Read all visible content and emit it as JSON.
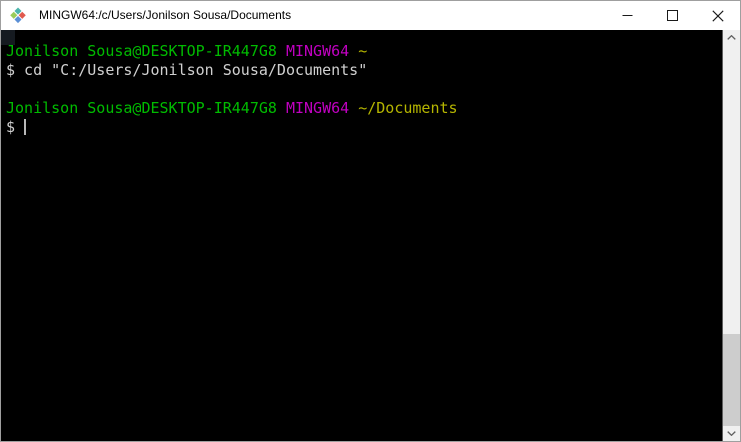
{
  "window": {
    "title": "MINGW64:/c/Users/Jonilson Sousa/Documents"
  },
  "icons": {
    "app": "msys-diamond-icon",
    "minimize": "minimize-icon",
    "maximize": "maximize-icon",
    "close": "close-icon",
    "scroll_up": "chevron-up-icon",
    "scroll_down": "chevron-down-icon"
  },
  "colors": {
    "green": "#00bb00",
    "magenta": "#c000c0",
    "yellow": "#b5b500",
    "fg": "#d0d0d0",
    "terminal_bg": "#000000",
    "titlebar_bg": "#ffffff",
    "cursor": "#b8b8b8",
    "scrollbar_track": "#f0f0f0",
    "scrollbar_thumb": "#cdcdcd"
  },
  "terminal": {
    "lines": [
      {
        "segments": [
          {
            "text": "Jonilson Sousa@DESKTOP-IR447G8 ",
            "color": "green"
          },
          {
            "text": "MINGW64 ",
            "color": "magenta"
          },
          {
            "text": "~",
            "color": "yellow"
          }
        ]
      },
      {
        "segments": [
          {
            "text": "$ cd \"C:/Users/Jonilson Sousa/Documents\"",
            "color": "fg"
          }
        ]
      },
      {
        "segments": []
      },
      {
        "segments": [
          {
            "text": "Jonilson Sousa@DESKTOP-IR447G8 ",
            "color": "green"
          },
          {
            "text": "MINGW64 ",
            "color": "magenta"
          },
          {
            "text": "~/Documents",
            "color": "yellow"
          }
        ]
      },
      {
        "segments": [
          {
            "text": "$ ",
            "color": "fg"
          }
        ],
        "cursor": true
      }
    ]
  }
}
